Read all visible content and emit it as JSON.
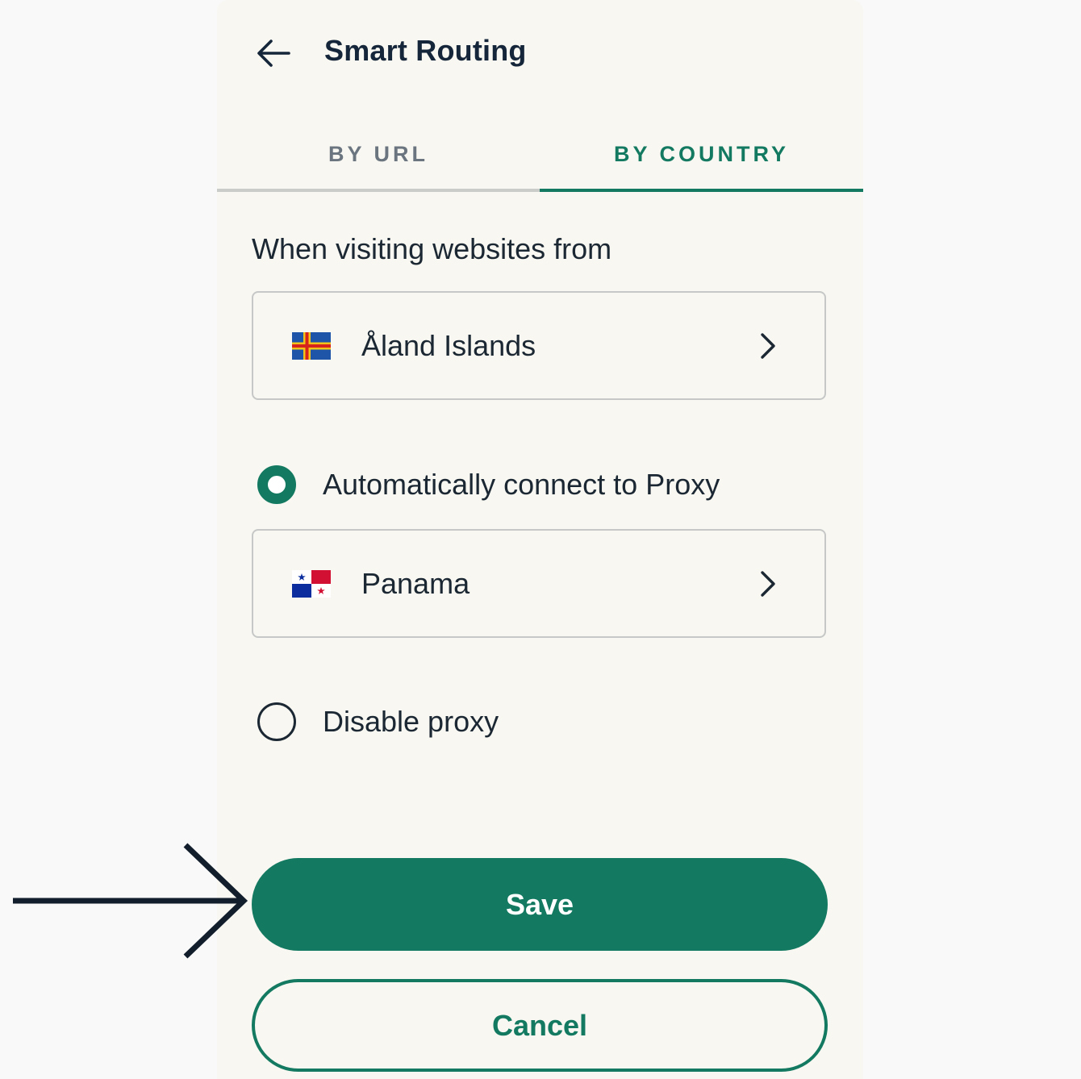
{
  "header": {
    "title": "Smart Routing",
    "back_icon": "arrow-left-icon"
  },
  "tabs": [
    {
      "label": "BY URL",
      "active": false
    },
    {
      "label": "BY COUNTRY",
      "active": true
    }
  ],
  "from_section": {
    "label": "When visiting websites from",
    "country": "Åland Islands",
    "flag_icon": "aland-islands-flag-icon"
  },
  "options": {
    "auto_connect": {
      "label": "Automatically connect to Proxy",
      "selected": true,
      "country": "Panama",
      "flag_icon": "panama-flag-icon"
    },
    "disable": {
      "label": "Disable proxy",
      "selected": false
    }
  },
  "actions": {
    "save_label": "Save",
    "cancel_label": "Cancel"
  },
  "colors": {
    "accent": "#137a61",
    "panel_bg": "#f8f7f1",
    "page_bg": "#f9f9f9",
    "text": "#1b2733"
  }
}
